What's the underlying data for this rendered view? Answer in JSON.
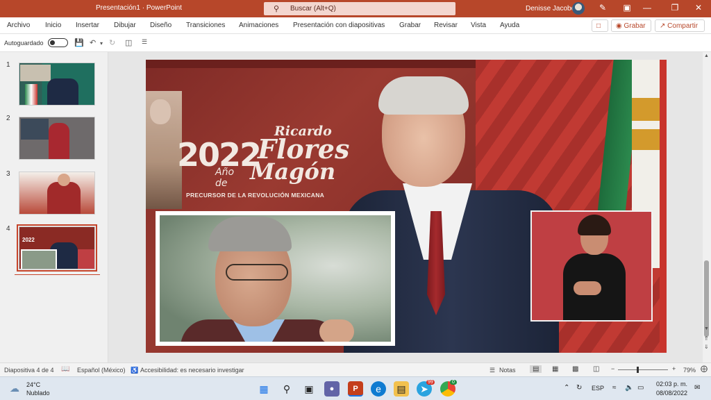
{
  "window": {
    "title": "Presentación1 · PowerPoint",
    "search_placeholder": "Buscar (Alt+Q)",
    "user": "Denisse Jacobo"
  },
  "menu": {
    "items": [
      "Archivo",
      "Inicio",
      "Insertar",
      "Dibujar",
      "Diseño",
      "Transiciones",
      "Animaciones",
      "Presentación con diapositivas",
      "Grabar",
      "Revisar",
      "Vista",
      "Ayuda"
    ],
    "record_label": "Grabar",
    "share_label": "Compartir"
  },
  "qat": {
    "autosave_label": "Autoguardado"
  },
  "thumbnails": [
    {
      "number": "1"
    },
    {
      "number": "2"
    },
    {
      "number": "3"
    },
    {
      "number": "4"
    }
  ],
  "slide": {
    "logo_year": "2022",
    "logo_ricardo": "Ricardo",
    "logo_flores": "Flores",
    "logo_anio": "Año de",
    "logo_magon": "Magón",
    "logo_subtitle": "PRECURSOR DE LA REVOLUCIÓN MEXICANA"
  },
  "status": {
    "slide_counter": "Diapositiva 4 de 4",
    "language": "Español (México)",
    "accessibility": "Accesibilidad: es necesario investigar",
    "notes": "Notas",
    "zoom": "79%"
  },
  "taskbar": {
    "temp": "24°C",
    "weather": "Nublado",
    "lang": "ESP",
    "time": "02:03 p. m.",
    "date": "08/08/2022",
    "telegram_badge": "99",
    "chrome_badge": "0"
  },
  "colors": {
    "accent": "#b7472a",
    "selection": "#c5442a"
  }
}
